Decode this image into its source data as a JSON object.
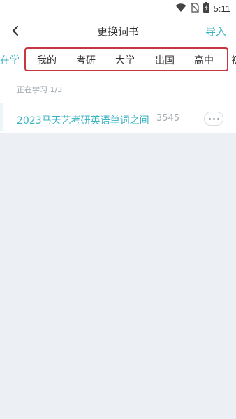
{
  "status_bar": {
    "time": "5:11",
    "icons": [
      "wifi-icon",
      "no-sim-icon",
      "battery-charging-icon"
    ]
  },
  "header": {
    "title": "更换词书",
    "action_label": "导入",
    "back_icon": "chevron-left-icon"
  },
  "tabs": {
    "active_partial": "在学",
    "items": [
      "我的",
      "考研",
      "大学",
      "出国",
      "高中"
    ],
    "partial_next": "初"
  },
  "section": {
    "label": "正在学习 1/3",
    "book": {
      "name": "2023马天艺考研英语单词之间",
      "count": "3545"
    }
  },
  "colors": {
    "accent": "#3bb3c3",
    "highlight_border": "#c8363f",
    "background": "#ecf0f4"
  }
}
